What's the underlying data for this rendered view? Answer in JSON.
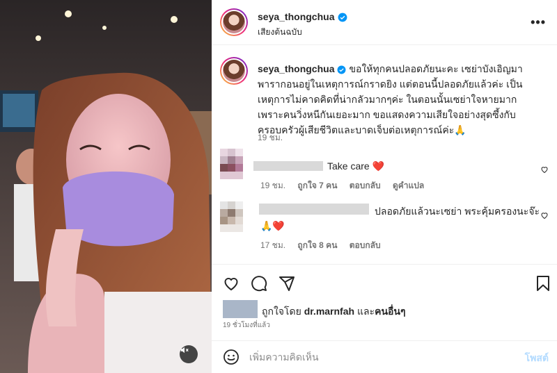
{
  "post": {
    "username": "seya_thongchua",
    "audio": "เสียงต้นฉบับ",
    "caption": "ขอให้ทุกคนปลอดภัยนะคะ เซย่าบังเอิญมาพารากอนอยู่ในเหตุการณ์กราดยิง แต่ตอนนี้ปลอดภัยแล้วค่ะ เป็นเหตุการไม่คาดคิดที่น่ากลัวมากๆค่ะ ในตอนนั้นเซย่าใจหายมาก เพราะคนวิ่งหนีกันเยอะมาก ขอแสดงความเสียใจอย่างสุดซึ้งกับครอบครัวผู้เสียชีวิตและบาดเจ็บต่อเหตุการณ์ค่ะ🙏",
    "caption_time": "19 ชม."
  },
  "comments": [
    {
      "text": "Take care",
      "emoji": "❤️",
      "time": "19 ชม.",
      "likes": "ถูกใจ 7 คน",
      "reply": "ตอบกลับ",
      "translate": "ดูคำแปล"
    },
    {
      "text": "ปลอดภัยแล้วนะเซย่า พระคุ้มครองนะจ๊ะ",
      "emoji": "🙏❤️",
      "time": "17 ชม.",
      "likes": "ถูกใจ 8 คน",
      "reply": "ตอบกลับ"
    }
  ],
  "likes": {
    "prefix": "ถูกใจโดย",
    "user": "dr.marnfah",
    "joiner": "และ",
    "others": "คนอื่นๆ"
  },
  "post_time": "19 ชั่วโมงที่แล้ว",
  "add_comment": {
    "placeholder": "เพิ่มความคิดเห็น",
    "post_label": "โพสต์"
  },
  "icons": {
    "more": "more-icon",
    "like": "heart-icon",
    "comment": "comment-icon",
    "share": "share-icon",
    "save": "bookmark-icon",
    "emoji": "emoji-icon",
    "mute": "speaker-muted-icon",
    "verified": "verified-badge-icon"
  },
  "colors": {
    "verified": "#0095f6",
    "heart": "#ed1b24",
    "post_button": "#b3dbff"
  }
}
